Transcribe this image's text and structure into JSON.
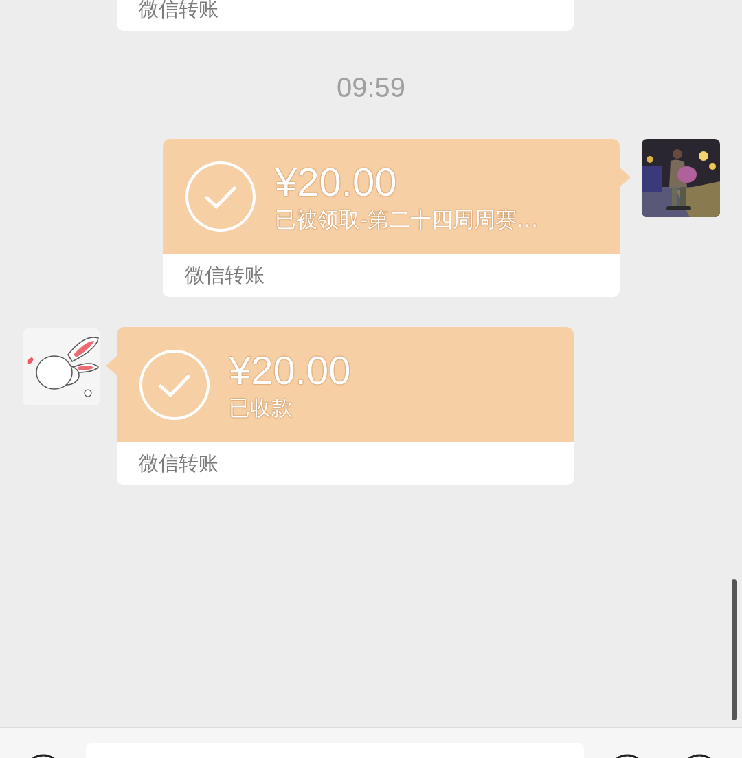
{
  "previous_footer": {
    "label": "微信转账"
  },
  "timestamp": "09:59",
  "messages": [
    {
      "kind": "sent",
      "amount": "¥20.00",
      "note": "已被领取-第二十四周周赛…",
      "footer": "微信转账"
    },
    {
      "kind": "received",
      "avatar": {
        "kind": "drawing"
      },
      "amount": "¥20.00",
      "note": "已收款",
      "footer": "微信转账"
    }
  ]
}
